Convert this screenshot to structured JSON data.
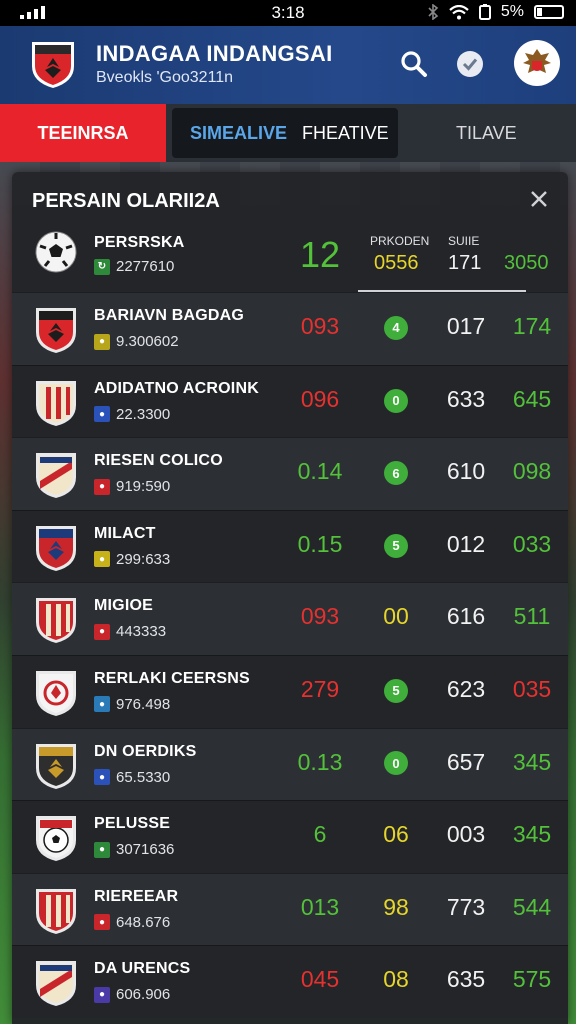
{
  "colors": {
    "red": "#e5312f",
    "green": "#53c13a",
    "yellow": "#e6d52a",
    "white": "#f2f2f2",
    "brand_blue": "#1e3f7c",
    "tab_red": "#e8232b"
  },
  "status": {
    "time": "3:18",
    "battery": "5%"
  },
  "header": {
    "title": "INDAGAA INDANGSAI",
    "subtitle": "Bveokls 'Goo3211n",
    "search_icon": "search-icon",
    "check_icon": "check-icon"
  },
  "tabs": {
    "first": "TEEINRSA",
    "live": "SIMEALIVE",
    "reactive": "FHEATIVE",
    "third": "TILAVE"
  },
  "panel": {
    "title": "PERSAIN OLARII2A",
    "top": {
      "name": "PERSRSKA",
      "sub": "2277610",
      "value": "12",
      "col1_label": "PRKODEN",
      "col1_value": "0556",
      "col2_label": "SUIIE",
      "col2_value": "171",
      "col3_value": "3050"
    }
  },
  "rows": [
    {
      "name": "BARIAVN BAGDAG",
      "sub": "9.300602",
      "c1": "093",
      "c1_color": "#e5312f",
      "c2": "4",
      "c2_type": "badge",
      "c3": "017",
      "c4": "174",
      "c4_color": "#53c13a"
    },
    {
      "name": "ADIDATNO ACROINK",
      "sub": "22.3300",
      "c1": "096",
      "c1_color": "#e5312f",
      "c2": "0",
      "c2_type": "badge",
      "c3": "633",
      "c4": "645",
      "c4_color": "#53c13a"
    },
    {
      "name": "RIESEN COLICO",
      "sub": "919:590",
      "c1": "0.14",
      "c1_color": "#53c13a",
      "c2": "6",
      "c2_type": "badge",
      "c3": "610",
      "c4": "098",
      "c4_color": "#53c13a"
    },
    {
      "name": "MILACT",
      "sub": "299:633",
      "c1": "0.15",
      "c1_color": "#53c13a",
      "c2": "5",
      "c2_type": "badge",
      "c3": "012",
      "c4": "033",
      "c4_color": "#53c13a"
    },
    {
      "name": "MIGIOE",
      "sub": "443333",
      "c1": "093",
      "c1_color": "#e5312f",
      "c2": "00",
      "c2_type": "text",
      "c2_color": "#e6d52a",
      "c3": "616",
      "c4": "511",
      "c4_color": "#53c13a"
    },
    {
      "name": "RERLAKI CEERSNS",
      "sub": "976.498",
      "c1": "279",
      "c1_color": "#e5312f",
      "c2": "5",
      "c2_type": "badge",
      "c3": "623",
      "c4": "035",
      "c4_color": "#e5312f"
    },
    {
      "name": "DN OERDIKS",
      "sub": "65.5330",
      "c1": "0.13",
      "c1_color": "#53c13a",
      "c2": "0",
      "c2_type": "badge",
      "c3": "657",
      "c4": "345",
      "c4_color": "#53c13a"
    },
    {
      "name": "PELUSSE",
      "sub": "3071636",
      "c1": "6",
      "c1_color": "#53c13a",
      "c2": "06",
      "c2_type": "text",
      "c2_color": "#e6d52a",
      "c3": "003",
      "c4": "345",
      "c4_color": "#53c13a"
    },
    {
      "name": "RIEREEAR",
      "sub": "648.676",
      "c1": "013",
      "c1_color": "#53c13a",
      "c2": "98",
      "c2_type": "text",
      "c2_color": "#e6d52a",
      "c3": "773",
      "c4": "544",
      "c4_color": "#53c13a"
    },
    {
      "name": "DA URENCS",
      "sub": "606.906",
      "c1": "045",
      "c1_color": "#e5312f",
      "c2": "08",
      "c2_type": "text",
      "c2_color": "#e6d52a",
      "c3": "635",
      "c4": "575",
      "c4_color": "#53c13a"
    }
  ]
}
